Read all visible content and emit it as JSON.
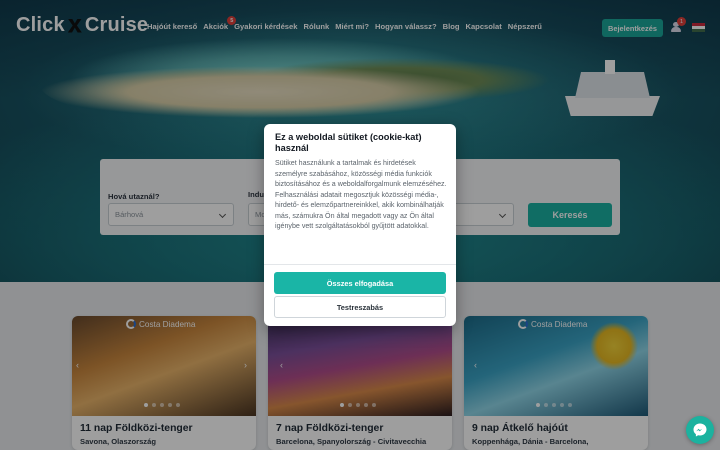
{
  "header": {
    "logo_left": "Click",
    "logo_right": "Cruise",
    "nav": [
      {
        "label": "Hajóút kereső"
      },
      {
        "label": "Akciók",
        "badge": "5"
      },
      {
        "label": "Gyakori kérdések"
      },
      {
        "label": "Rólunk"
      },
      {
        "label": "Miért mi?"
      },
      {
        "label": "Hogyan válassz?"
      },
      {
        "label": "Blog"
      },
      {
        "label": "Kapcsolat"
      },
      {
        "label": "Népszerű"
      }
    ],
    "login_label": "Bejelentkezés",
    "user_badge": "1",
    "colors": {
      "accent": "#1aa69a",
      "badge": "#e0403a"
    },
    "flag_colors": [
      "#cd2a3e",
      "#ffffff",
      "#436f4d"
    ]
  },
  "search": {
    "destination_label": "Hová utaznál?",
    "destination_placeholder": "Bárhová",
    "departure_label": "Indu",
    "departure_placeholder": "Mo",
    "third_field_value": "",
    "search_label": "Keresés"
  },
  "cookie": {
    "title": "Ez a weboldal sütiket (cookie-kat) használ",
    "body": "Sütiket használunk a tartalmak és hirdetések személyre szabásához, közösségi média funkciók biztosításához és a weboldalforgalmunk elemzéséhez. Felhasználási adatait megosztjuk közösségi média-, hirdető- és elemzőpartnereinkkel, akik kombinálhatják más, számukra Ön által megadott vagy az Ön által igénybe vett szolgáltatásokból gyűjtött adatokkal.",
    "accept_label": "Összes elfogadása",
    "customize_label": "Testreszabás"
  },
  "cards": [
    {
      "brand": "Costa Diadema",
      "title": "11 nap Földközi-tenger",
      "subtitle": "Savona, Olaszország"
    },
    {
      "brand": "",
      "title": "7 nap Földközi-tenger",
      "subtitle": "Barcelona, Spanyolország - Civitavecchia"
    },
    {
      "brand": "Costa Diadema",
      "title": "9 nap Átkelő hajóút",
      "subtitle": "Koppenhága, Dánia - Barcelona,"
    }
  ]
}
